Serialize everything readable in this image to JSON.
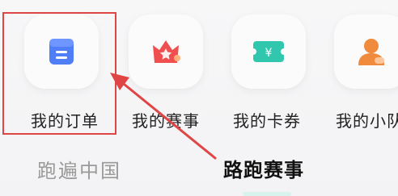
{
  "menu": {
    "items": [
      {
        "label": "我的订单",
        "icon": "orders-icon",
        "color": "#4f7ef6"
      },
      {
        "label": "我的赛事",
        "icon": "crown-events-icon",
        "color": "#ef4f4f"
      },
      {
        "label": "我的卡券",
        "icon": "coupon-icon",
        "color": "#31c6ae"
      },
      {
        "label": "我的小队",
        "icon": "team-icon",
        "color": "#f08a3c"
      }
    ]
  },
  "section": {
    "title": "跑遍中国"
  },
  "annotation": {
    "text": "路跑赛事",
    "highlight_color": "#e04545"
  }
}
